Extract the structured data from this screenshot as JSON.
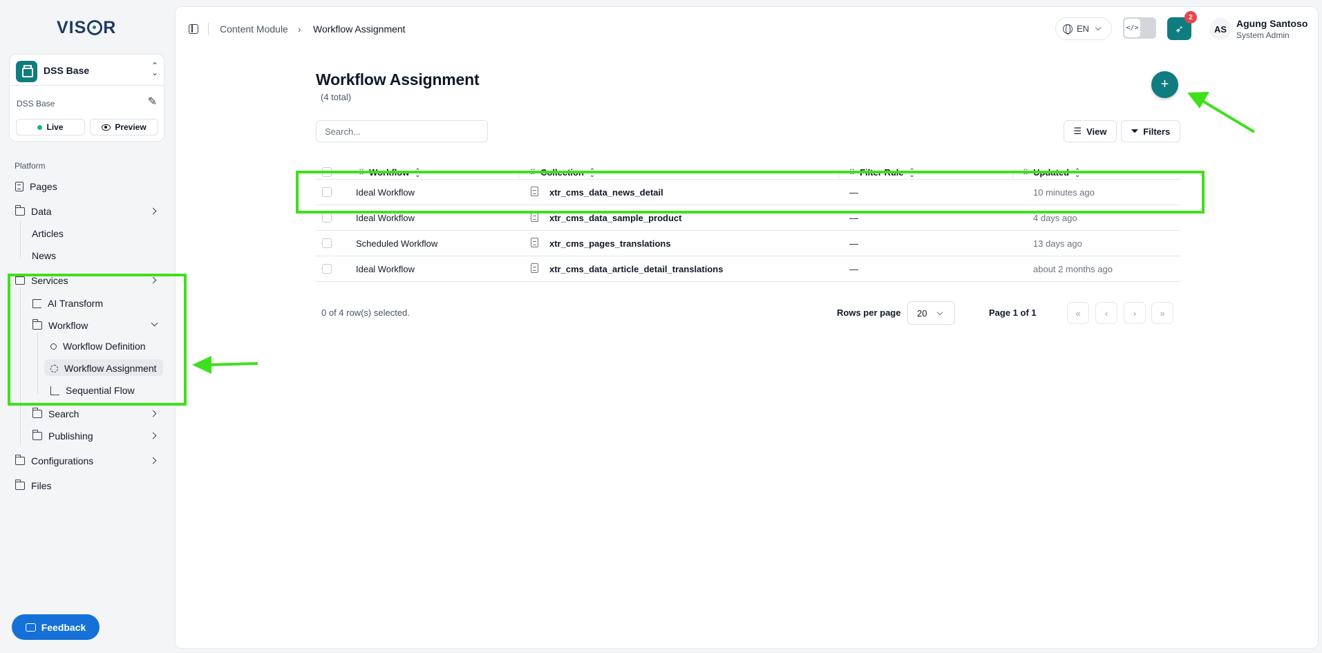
{
  "sidebar": {
    "logo": "VISOR",
    "workspace": {
      "name": "DSS Base",
      "sub_label": "DSS Base",
      "live_label": "Live",
      "preview_label": "Preview"
    },
    "section_label": "Platform",
    "items": {
      "pages": "Pages",
      "data": "Data",
      "articles": "Articles",
      "news": "News",
      "services": "Services",
      "ai_transform": "AI Transform",
      "workflow": "Workflow",
      "workflow_definition": "Workflow Definition",
      "workflow_assignment": "Workflow Assignment",
      "sequential_flow": "Sequential Flow",
      "search": "Search",
      "publishing": "Publishing",
      "configurations": "Configurations",
      "files": "Files"
    },
    "feedback_label": "Feedback"
  },
  "header": {
    "breadcrumb": [
      "Content Module",
      "Workflow Assignment"
    ],
    "breadcrumb_sep": "›",
    "language": "EN",
    "dev_toggle": "</>",
    "notification_count": "2",
    "user": {
      "initials": "AS",
      "name": "Agung Santoso",
      "role": "System Admin"
    }
  },
  "page": {
    "title": "Workflow Assignment",
    "total": "(4 total)",
    "add_label": "+",
    "search_placeholder": "Search...",
    "view_label": "View",
    "filters_label": "Filters"
  },
  "table": {
    "columns": [
      "Workflow",
      "Collection",
      "Filter Rule",
      "Updated"
    ],
    "rows": [
      {
        "workflow": "Ideal Workflow",
        "collection": "xtr_cms_data_news_detail",
        "filter_rule": "—",
        "updated": "10 minutes ago"
      },
      {
        "workflow": "Ideal Workflow",
        "collection": "xtr_cms_data_sample_product",
        "filter_rule": "—",
        "updated": "4 days ago"
      },
      {
        "workflow": "Scheduled Workflow",
        "collection": "xtr_cms_pages_translations",
        "filter_rule": "—",
        "updated": "13 days ago"
      },
      {
        "workflow": "Ideal Workflow",
        "collection": "xtr_cms_data_article_detail_translations",
        "filter_rule": "—",
        "updated": "about 2 months ago"
      }
    ],
    "selection": "0 of 4 row(s) selected.",
    "rows_per_page_label": "Rows per page",
    "rows_per_page": "20",
    "page_info": "Page 1 of 1"
  },
  "colors": {
    "accent": "#0f7c80",
    "annotation": "#3ee01c",
    "feedback": "#1570d8",
    "badge": "#e5484d"
  }
}
